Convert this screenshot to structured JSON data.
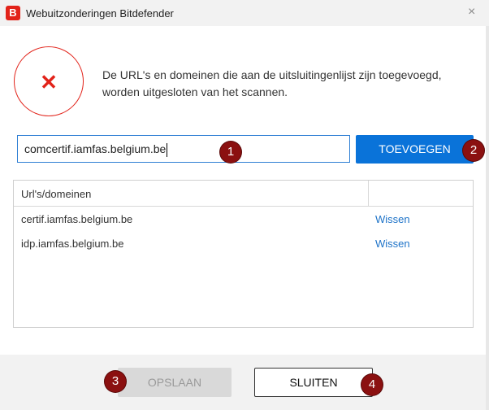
{
  "window": {
    "app_icon_letter": "B",
    "title": "Webuitzonderingen Bitdefender",
    "close_glyph": "×"
  },
  "icon": {
    "name": "error-x-icon",
    "glyph": "✕",
    "color": "#e2231a"
  },
  "description": "De URL's en domeinen die aan de uitsluitingenlijst zijn toegevoegd, worden uitgesloten van het scannen.",
  "input": {
    "value": "comcertif.iamfas.belgium.be"
  },
  "add_button": {
    "label": "TOEVOEGEN"
  },
  "table": {
    "header": "Url's/domeinen",
    "rows": [
      {
        "url": "certif.iamfas.belgium.be",
        "action": "Wissen"
      },
      {
        "url": "idp.iamfas.belgium.be",
        "action": "Wissen"
      }
    ]
  },
  "footer": {
    "save_label": "OPSLAAN",
    "close_label": "SLUITEN"
  },
  "badges": [
    "1",
    "2",
    "3",
    "4"
  ],
  "colors": {
    "accent": "#0a73d9",
    "brand": "#e2231a",
    "badge": "#8b1010",
    "link": "#1e73c8"
  }
}
